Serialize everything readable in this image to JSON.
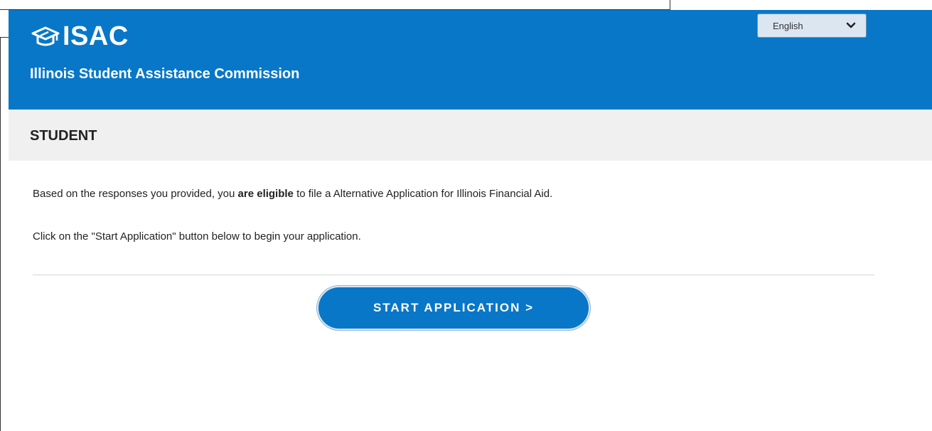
{
  "header": {
    "logo_text": "ISAC",
    "subtitle": "Illinois Student Assistance Commission",
    "language": {
      "selected": "English"
    }
  },
  "section": {
    "title": "STUDENT"
  },
  "content": {
    "eligibility_prefix": "Based on the responses you provided, you ",
    "eligibility_emphasis": "are eligible",
    "eligibility_suffix": " to file a Alternative Application for Illinois Financial Aid.",
    "instruction": "Click on the \"Start Application\" button below to begin your application."
  },
  "actions": {
    "start_application_label": "START APPLICATION >"
  },
  "colors": {
    "brand_blue": "#0877c8",
    "section_gray": "#f0f0f0"
  },
  "icons": {
    "logo": "graduation-cap-icon",
    "dropdown": "chevron-down-icon"
  }
}
